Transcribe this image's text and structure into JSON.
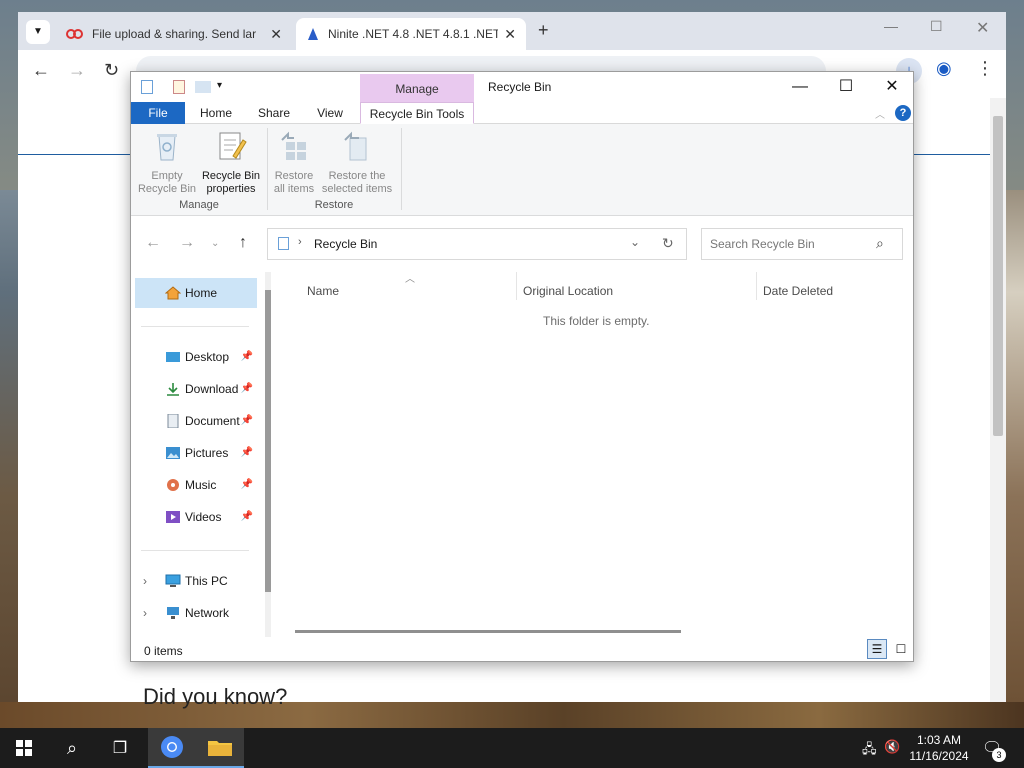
{
  "browser": {
    "tabs": [
      {
        "title": "File upload & sharing. Send lar",
        "active": false
      },
      {
        "title": "Ninite .NET 4.8 .NET 4.8.1 .NET",
        "active": true
      }
    ],
    "new_tab_label": "+",
    "page_heading": "Did you know?"
  },
  "explorer": {
    "window_title": "Recycle Bin",
    "context_tab_group": "Manage",
    "ribbon_tabs": [
      "File",
      "Home",
      "Share",
      "View",
      "Recycle Bin Tools"
    ],
    "ribbon": {
      "manage_group": "Manage",
      "restore_group": "Restore",
      "empty_line1": "Empty",
      "empty_line2": "Recycle Bin",
      "props_line1": "Recycle Bin",
      "props_line2": "properties",
      "restore_all_line1": "Restore",
      "restore_all_line2": "all items",
      "restore_sel_line1": "Restore the",
      "restore_sel_line2": "selected items"
    },
    "address_path": "Recycle Bin",
    "search_placeholder": "Search Recycle Bin",
    "nav": {
      "home": "Home",
      "quick": [
        {
          "label": "Desktop"
        },
        {
          "label": "Download"
        },
        {
          "label": "Document"
        },
        {
          "label": "Pictures"
        },
        {
          "label": "Music"
        },
        {
          "label": "Videos"
        }
      ],
      "this_pc": "This PC",
      "network": "Network"
    },
    "columns": [
      "Name",
      "Original Location",
      "Date Deleted"
    ],
    "empty_message": "This folder is empty.",
    "status": "0 items"
  },
  "taskbar": {
    "time": "1:03 AM",
    "date": "11/16/2024",
    "notification_count": "3"
  },
  "colors": {
    "file_tab": "#1c68c3",
    "context_tab": "#e9c9ef",
    "selected_nav": "#cce4f7",
    "taskbar": "#1c1c1c"
  }
}
